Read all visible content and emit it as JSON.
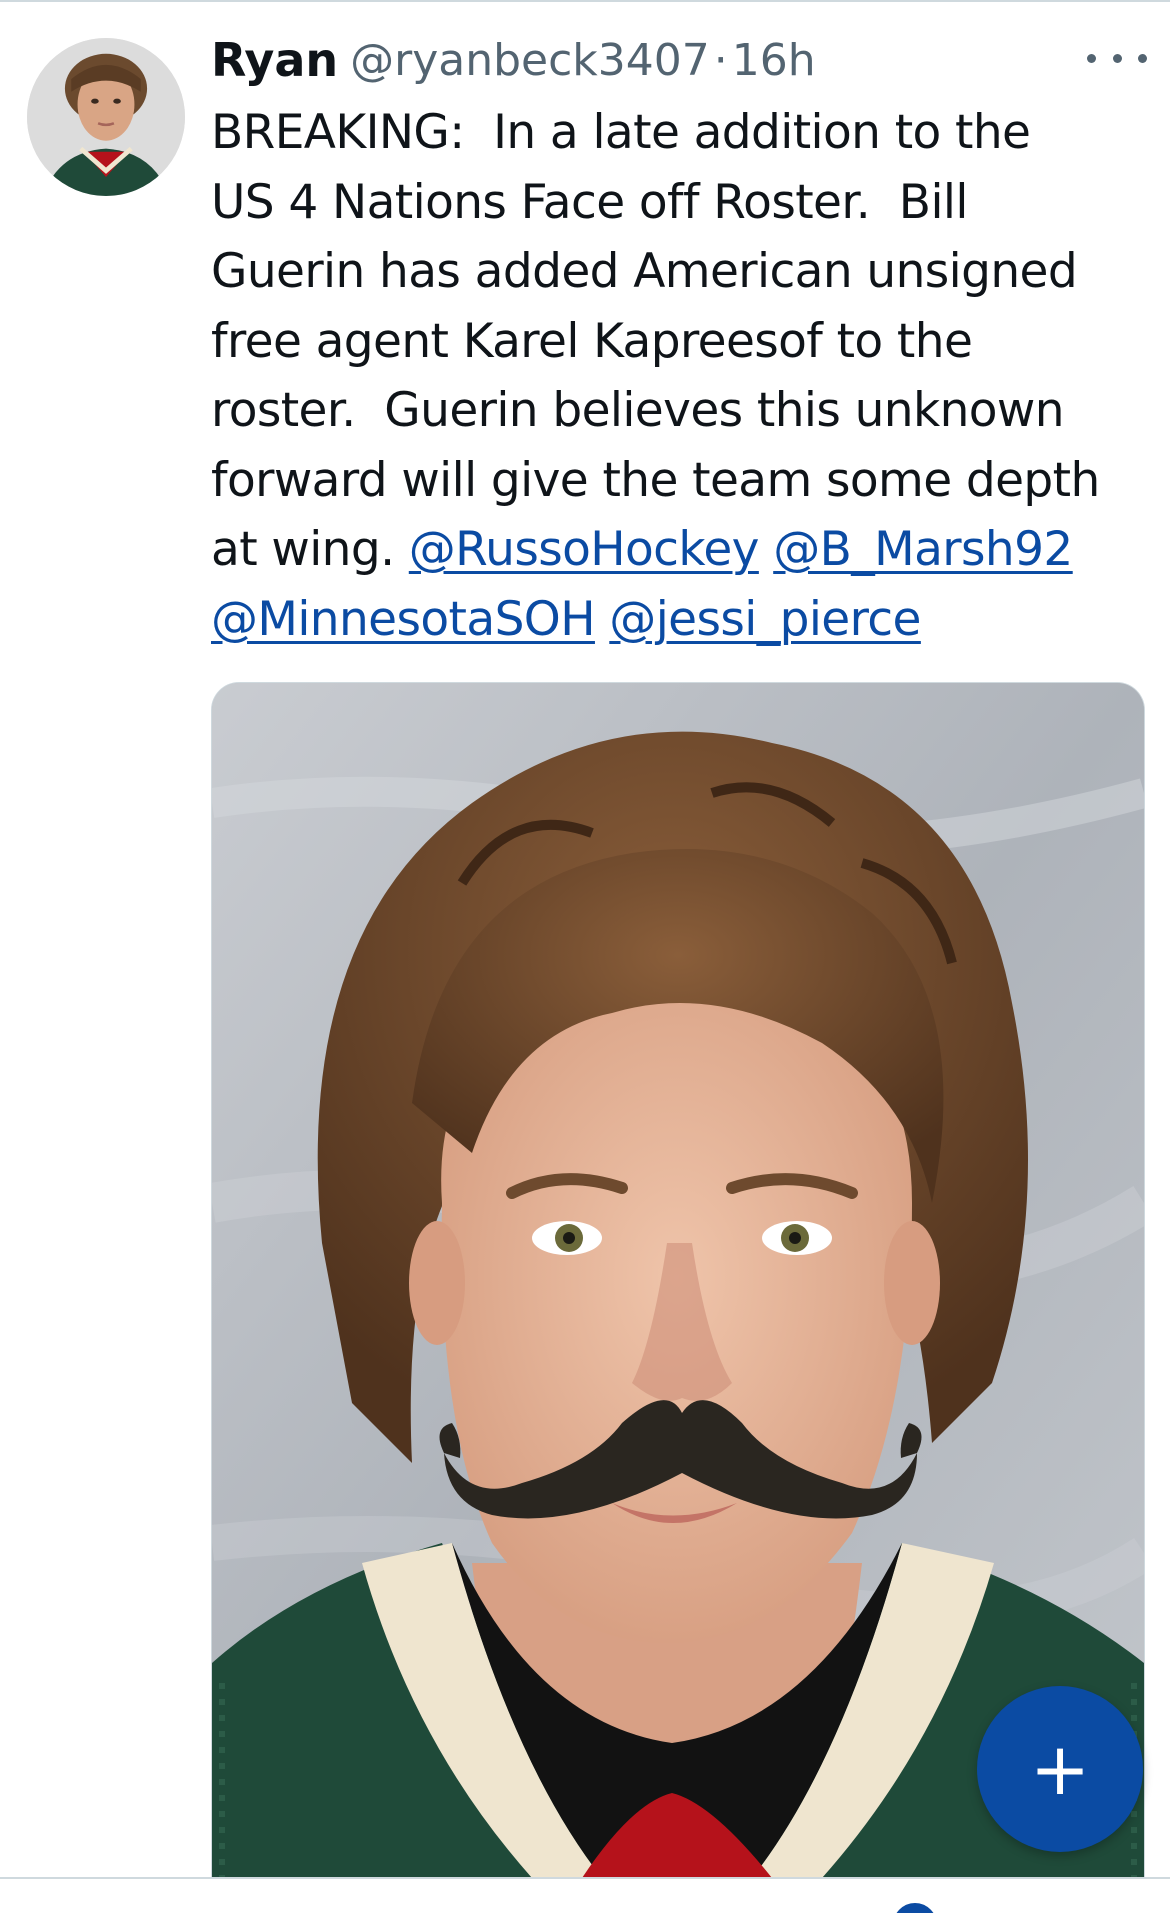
{
  "tweet": {
    "author_name": "Ryan",
    "author_handle": "@ryanbeck3407",
    "separator": "·",
    "time": "16h",
    "text_lines": [
      "BREAKING:  In a late addition to the",
      "US 4 Nations Face off Roster.  Bill",
      "Guerin has added American unsigned",
      "free agent Karel Kapreesof to the",
      "roster.  Guerin believes this unknown",
      "forward will give the team some depth"
    ],
    "text_last_prefix": "at wing. ",
    "mentions": [
      "@RussoHockey",
      "@B_Marsh92",
      "@MinnesotaSOH",
      "@jessi_pierce"
    ]
  },
  "actions": {
    "more_icon": "more-horizontal-icon",
    "compose_icon": "plus-icon",
    "compose_label": "+"
  },
  "colors": {
    "link": "#0b4ba3",
    "text": "#0f1419",
    "secondary": "#536471",
    "fab": "#0b4ba3",
    "jersey_green": "#1f4a39",
    "jersey_red": "#b5121b"
  }
}
